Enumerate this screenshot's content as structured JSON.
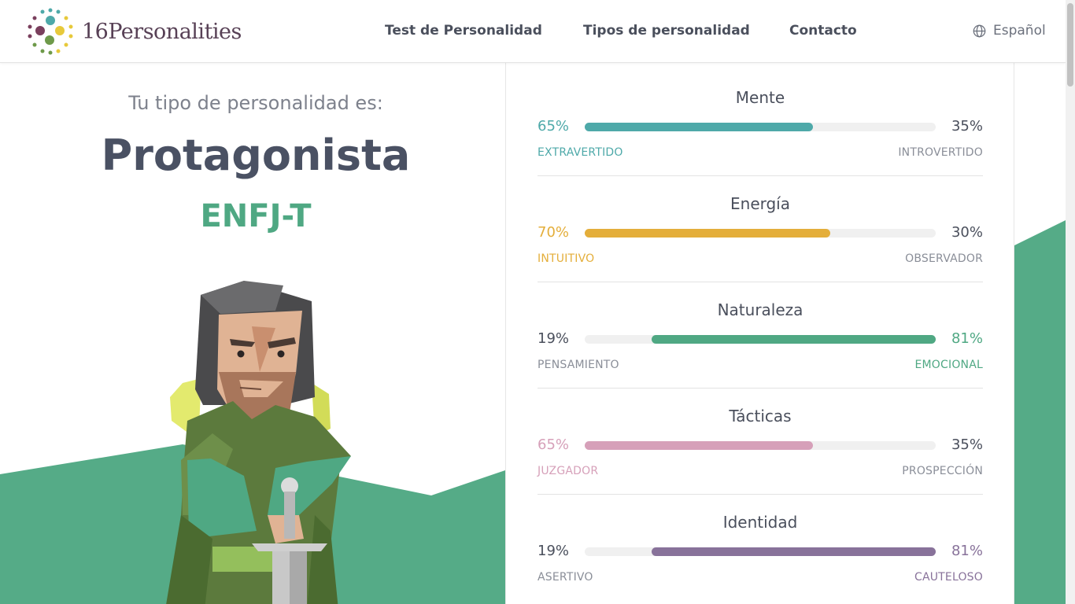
{
  "header": {
    "brand": "16Personalities",
    "nav": [
      "Test de Personalidad",
      "Tipos de personalidad",
      "Contacto"
    ],
    "language": "Español"
  },
  "result": {
    "subtitle": "Tu tipo de personalidad es:",
    "type_name": "Protagonista",
    "type_code": "ENFJ-T"
  },
  "traits": [
    {
      "title": "Mente",
      "left_pct": "65%",
      "right_pct": "35%",
      "left_label": "EXTRAVERTIDO",
      "right_label": "INTROVERTIDO",
      "dominant": "left",
      "fill_fraction": 0.65,
      "color": "#4ea9a9"
    },
    {
      "title": "Energía",
      "left_pct": "70%",
      "right_pct": "30%",
      "left_label": "INTUITIVO",
      "right_label": "OBSERVADOR",
      "dominant": "left",
      "fill_fraction": 0.7,
      "color": "#e4ae3a"
    },
    {
      "title": "Naturaleza",
      "left_pct": "19%",
      "right_pct": "81%",
      "left_label": "PENSAMIENTO",
      "right_label": "EMOCIONAL",
      "dominant": "right",
      "fill_fraction": 0.81,
      "color": "#4fa883"
    },
    {
      "title": "Tácticas",
      "left_pct": "65%",
      "right_pct": "35%",
      "left_label": "JUZGADOR",
      "right_label": "PROSPECCIÓN",
      "dominant": "left",
      "fill_fraction": 0.65,
      "color": "#d6a0b9"
    },
    {
      "title": "Identidad",
      "left_pct": "19%",
      "right_pct": "81%",
      "left_label": "ASERTIVO",
      "right_label": "CAUTELOSO",
      "dominant": "right",
      "fill_fraction": 0.81,
      "color": "#88729a"
    }
  ],
  "colors": {
    "accent_green": "#55ab87",
    "heading": "#4a5163"
  }
}
